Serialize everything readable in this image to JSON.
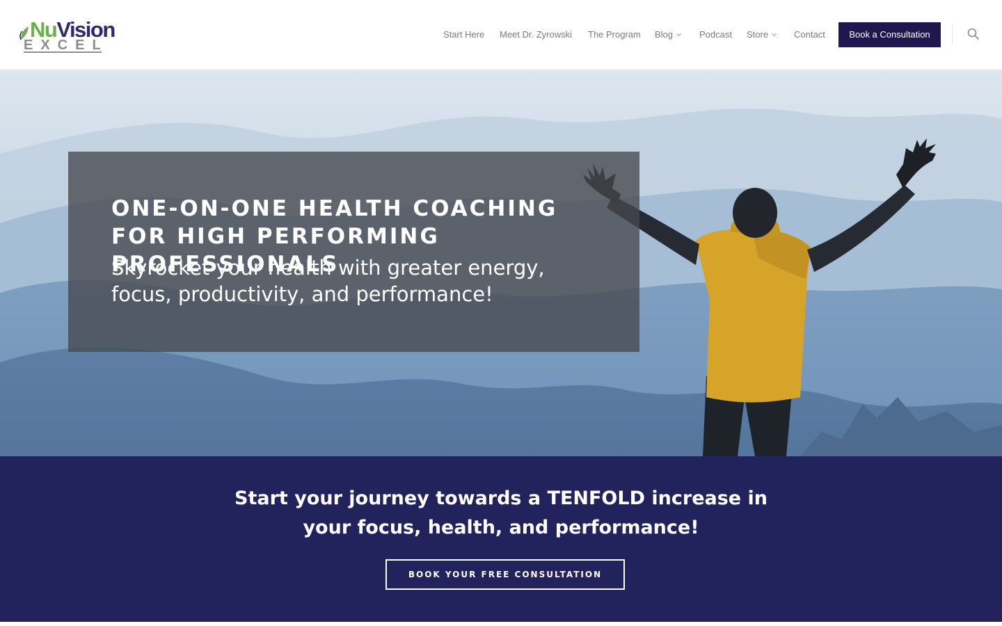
{
  "brand": {
    "logo_nu": "Nu",
    "logo_vision": "Vision",
    "logo_excel": "EXCEL",
    "colors": {
      "green": "#6ab04c",
      "navy": "#2c2874",
      "gray": "#8d8d8d"
    }
  },
  "nav": {
    "items": [
      {
        "label": "Start Here",
        "has_dropdown": false
      },
      {
        "label": "Meet Dr. Zyrowski",
        "has_dropdown": false
      },
      {
        "label": "The Program",
        "has_dropdown": false
      },
      {
        "label": "Blog",
        "has_dropdown": true
      },
      {
        "label": "Podcast",
        "has_dropdown": false
      },
      {
        "label": "Store",
        "has_dropdown": true
      },
      {
        "label": "Contact",
        "has_dropdown": false
      }
    ],
    "cta_label": "Book a Consultation",
    "search_icon": "search-icon",
    "dropdown_icon": "chevron-down-icon",
    "cta_color": "#21174f"
  },
  "hero": {
    "title": "One-on-One Health Coaching for High Performing Professionals",
    "subtitle": "Skyrocket your health with greater energy, focus, productivity, and performance!"
  },
  "journey": {
    "heading": "Start your journey towards a TENFOLD increase in your focus, health, and performance!",
    "button_label": "BOOK YOUR FREE CONSULTATION",
    "background": "#22235c"
  }
}
